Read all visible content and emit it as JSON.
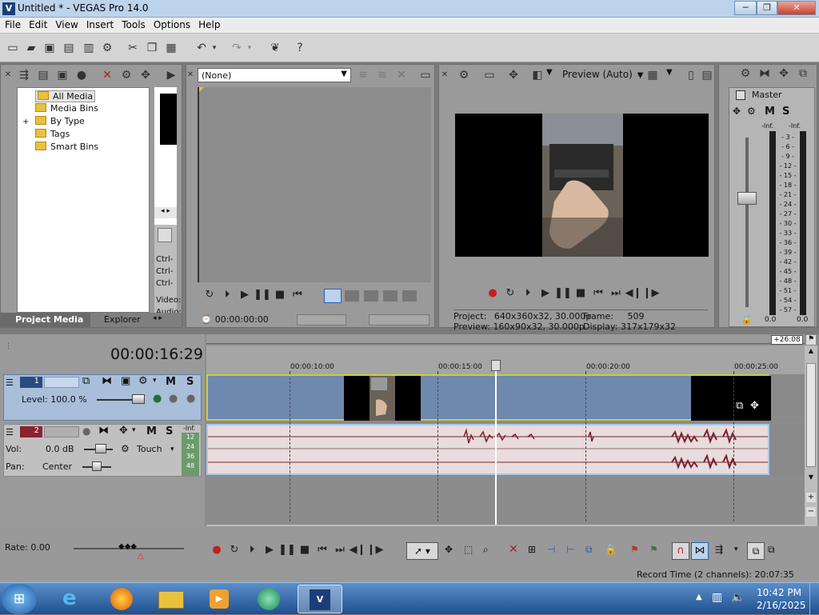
{
  "window": {
    "title": "Untitled * - VEGAS Pro 14.0",
    "logo": "V",
    "minimize": "─",
    "restore": "❐",
    "close": "✕"
  },
  "menu": [
    "File",
    "Edit",
    "View",
    "Insert",
    "Tools",
    "Options",
    "Help"
  ],
  "project_media": {
    "tree": [
      "All Media",
      "Media Bins",
      "By Type",
      "Tags",
      "Smart Bins"
    ],
    "expand_glyph": "+",
    "side_labels": [
      "Ctrl-",
      "Ctrl-",
      "Ctrl-",
      "Video:",
      "Audio:"
    ],
    "tabs": [
      "Project Media",
      "Explorer"
    ]
  },
  "trimmer": {
    "dropdown": "(None)",
    "timecode": "00:00:00:00"
  },
  "preview": {
    "mode": "Preview (Auto)",
    "project_label": "Project:",
    "project_value": "640x360x32, 30.000p",
    "preview_label": "Preview:",
    "preview_value": "160x90x32, 30.000p",
    "frame_label": "Frame:",
    "frame_value": "509",
    "display_label": "Display:",
    "display_value": "317x179x32"
  },
  "mixer": {
    "master": "Master",
    "m": "M",
    "s": "S",
    "inf_left": "-Inf.",
    "inf_right": "-Inf.",
    "scale": [
      "3",
      "6",
      "9",
      "12",
      "15",
      "18",
      "21",
      "24",
      "27",
      "30",
      "33",
      "36",
      "39",
      "42",
      "45",
      "48",
      "51",
      "54",
      "57"
    ],
    "bottom_left": "0.0",
    "bottom_right": "0.0"
  },
  "timeline": {
    "cursor_time": "00:00:16:29",
    "ruler_badge": "+26:08",
    "ruler": [
      "00:00:10:00",
      "00:00:15:00",
      "00:00:20:00",
      "00:00:25:00"
    ],
    "video_track": {
      "number": "1",
      "level": "Level: 100.0 %",
      "m": "M",
      "s": "S"
    },
    "audio_track": {
      "number": "2",
      "vol_label": "Vol:",
      "vol_value": "0.0 dB",
      "pan_label": "Pan:",
      "pan_value": "Center",
      "touch": "Touch",
      "m": "M",
      "s": "S",
      "inf": "-Inf.",
      "scale": [
        "12",
        "24",
        "36",
        "48"
      ]
    }
  },
  "status": {
    "rate": "Rate: 0.00",
    "record_time": "Record Time (2 channels): 20:07:35"
  },
  "taskbar": {
    "time": "10:42 PM",
    "date": "2/16/2025"
  }
}
